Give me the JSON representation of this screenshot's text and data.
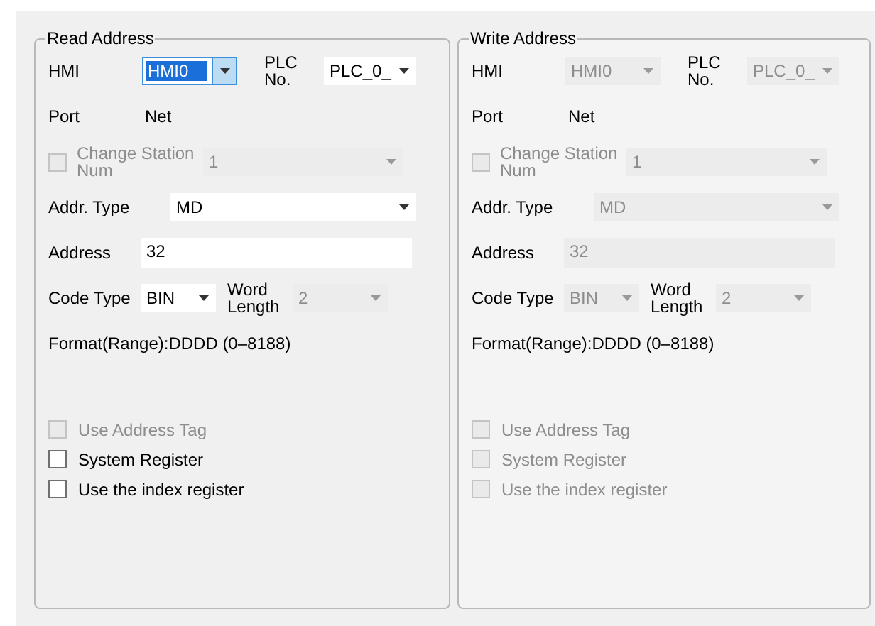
{
  "panels": [
    {
      "title": "Read Address",
      "hmi": {
        "label": "HMI",
        "value": "HMI0",
        "focused": true,
        "disabled": false
      },
      "plc": {
        "label": "PLC No.",
        "value": "PLC_0_",
        "disabled": false
      },
      "port": {
        "label": "Port",
        "value": "Net"
      },
      "station": {
        "label": "Change Station Num",
        "checked": false,
        "disabled": true,
        "value": "1"
      },
      "addr_type": {
        "label": "Addr. Type",
        "value": "MD",
        "disabled": false
      },
      "address": {
        "label": "Address",
        "value": "32",
        "disabled": false
      },
      "code_type": {
        "label": "Code Type",
        "value": "BIN",
        "disabled": false
      },
      "word_length": {
        "label": "Word Length",
        "value": "2",
        "disabled": true
      },
      "format": "Format(Range):DDDD (0–8188)",
      "options": [
        {
          "label": "Use Address Tag",
          "checked": false,
          "disabled": true
        },
        {
          "label": "System Register",
          "checked": false,
          "disabled": false
        },
        {
          "label": "Use the index register",
          "checked": false,
          "disabled": false
        }
      ]
    },
    {
      "title": "Write Address",
      "hmi": {
        "label": "HMI",
        "value": "HMI0",
        "focused": false,
        "disabled": true
      },
      "plc": {
        "label": "PLC No.",
        "value": "PLC_0_",
        "disabled": true
      },
      "port": {
        "label": "Port",
        "value": "Net"
      },
      "station": {
        "label": "Change Station Num",
        "checked": false,
        "disabled": true,
        "value": "1"
      },
      "addr_type": {
        "label": "Addr. Type",
        "value": "MD",
        "disabled": true
      },
      "address": {
        "label": "Address",
        "value": "32",
        "disabled": true
      },
      "code_type": {
        "label": "Code Type",
        "value": "BIN",
        "disabled": true
      },
      "word_length": {
        "label": "Word Length",
        "value": "2",
        "disabled": true
      },
      "format": "Format(Range):DDDD (0–8188)",
      "options": [
        {
          "label": "Use Address Tag",
          "checked": false,
          "disabled": true
        },
        {
          "label": "System Register",
          "checked": false,
          "disabled": true
        },
        {
          "label": "Use the index register",
          "checked": false,
          "disabled": true
        }
      ]
    }
  ]
}
